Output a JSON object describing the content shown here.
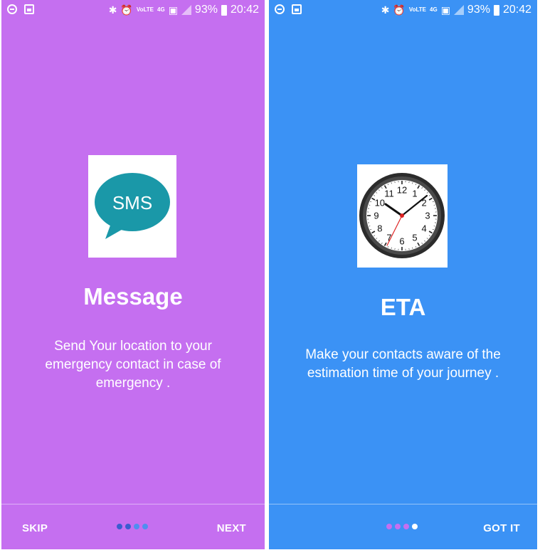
{
  "status_bar": {
    "battery": "93%",
    "time": "20:42",
    "volte": "VoLTE",
    "network": "4G"
  },
  "slides": [
    {
      "icon_text": "SMS",
      "title": "Message",
      "description": "Send Your location to your emergency contact in case of emergency .",
      "background": "#c56ff0",
      "skip_label": "SKIP",
      "action_label": "NEXT",
      "dots": [
        "#3b5cd0",
        "#3b5cd0",
        "#4f8ef0",
        "#4f8ef0"
      ]
    },
    {
      "title": "ETA",
      "description": "Make your contacts aware of the estimation time of your journey .",
      "background": "#3b92f5",
      "action_label": "GOT IT",
      "dots": [
        "#c56ff0",
        "#c56ff0",
        "#c56ff0",
        "#ffffff"
      ]
    }
  ],
  "clock_numbers": [
    "12",
    "1",
    "2",
    "3",
    "4",
    "5",
    "6",
    "7",
    "8",
    "9",
    "10",
    "11"
  ]
}
